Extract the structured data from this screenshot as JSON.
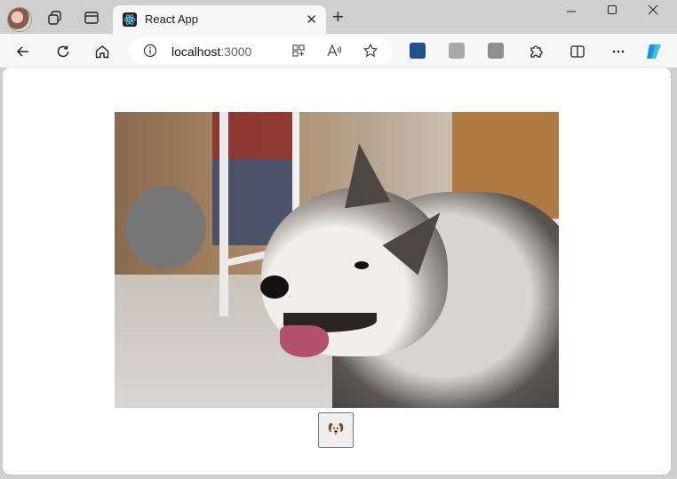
{
  "browser": {
    "tab_title": "React App",
    "tab_close_glyph": "✕",
    "new_tab_glyph": "+",
    "url_host": "localhost",
    "url_port": ":3000"
  },
  "page": {
    "image_alt": "dog-photo",
    "dog_button_icon": "dog-face-icon"
  }
}
